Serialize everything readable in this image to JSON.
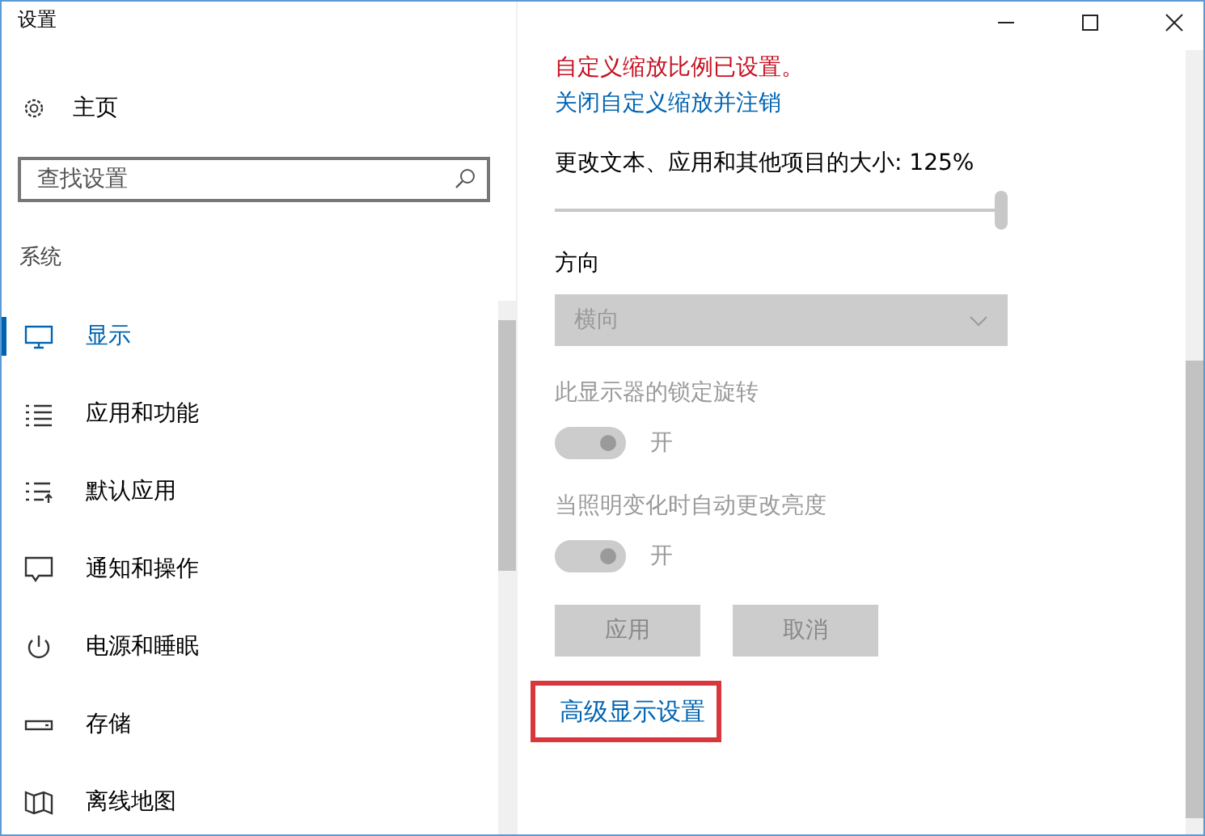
{
  "window": {
    "title": "设置"
  },
  "sidebar": {
    "home": "主页",
    "search": {
      "placeholder": "查找设置"
    },
    "section": "系统",
    "items": [
      {
        "label": "显示",
        "selected": true
      },
      {
        "label": "应用和功能",
        "selected": false
      },
      {
        "label": "默认应用",
        "selected": false
      },
      {
        "label": "通知和操作",
        "selected": false
      },
      {
        "label": "电源和睡眠",
        "selected": false
      },
      {
        "label": "存储",
        "selected": false
      },
      {
        "label": "离线地图",
        "selected": false
      }
    ]
  },
  "content": {
    "notice": "自定义缩放比例已设置。",
    "notice_link": "关闭自定义缩放并注销",
    "scale": {
      "label": "更改文本、应用和其他项目的大小: 125%",
      "level": 1.0
    },
    "orientation": {
      "label": "方向",
      "value": "横向",
      "disabled": true
    },
    "toggles": [
      {
        "label": "此显示器的锁定旋转",
        "state_text": "开",
        "on": true,
        "disabled": true
      },
      {
        "label": "当照明变化时自动更改亮度",
        "state_text": "开",
        "on": true,
        "disabled": true
      }
    ],
    "buttons": [
      {
        "label": "应用",
        "disabled": true
      },
      {
        "label": "取消",
        "disabled": true
      }
    ],
    "advanced_link": {
      "label": "高级显示设置",
      "highlighted": true
    }
  }
}
